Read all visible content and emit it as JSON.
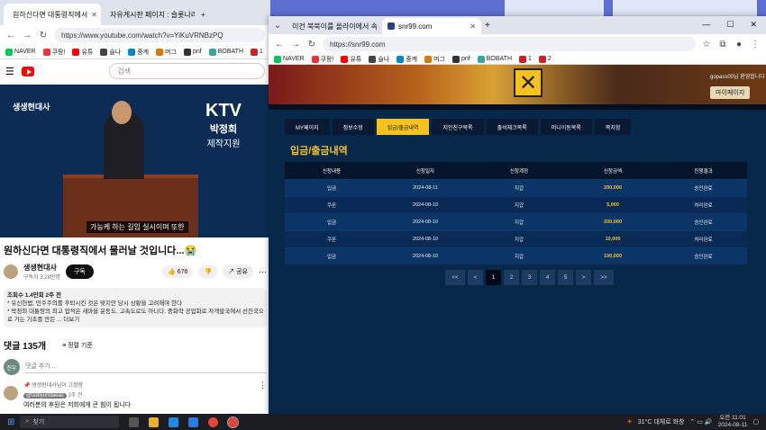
{
  "desktop": {
    "bg": "#5d6fd1"
  },
  "left_browser": {
    "tabs": [
      {
        "label": "원하신다면 대통령직에서",
        "active": true
      },
      {
        "label": "자유게시판 페이지 : 슬롯나라",
        "active": false
      }
    ],
    "new_tab": "+",
    "url": "https://www.youtube.com/watch?v=YiKuVRNBzPQ",
    "bookmarks": [
      "NAVER",
      "쿠팡!",
      "유튜",
      "슬나",
      "중계",
      "머그",
      "pnf",
      "BOBATH",
      "1",
      "2"
    ],
    "search_placeholder": "검색",
    "video": {
      "channel_tag": "생생현대사",
      "ktv_line1": "KTV",
      "ktv_line2": "박정희",
      "ktv_line3": "제작지원",
      "caption": "가능케 하는 길임 실시이며 또한"
    },
    "title": "원하신다면 대통령직에서 물러날 것입니다...😭",
    "channel": "생생현대사",
    "subs": "구독자 3.28만명",
    "subscribe": "구독",
    "likes": "676",
    "share": "공유",
    "desc_line1": "조회수 1.4만회  2주 전",
    "desc_line2": "* 유신헌법, 민주주의를 후퇴시킨 것은 맞지만 당시 상황을 고려해야 한다",
    "desc_line3": "* 박정희 대통령의 최고 업적은 새마을 운동도, 고속도로도 아니다. 중화학 공업화로 자개발국에서 선진국으",
    "desc_line4": "로 가는 기초를 만든 ... 더보기",
    "comments_count": "댓글 135개",
    "sort": "정렬 기준",
    "add_comment": "댓글 추가...",
    "me_avatar": "진우",
    "pinned": "생생현대사님이 고정함",
    "commenter": "@sobyundaeas",
    "comment_time": "2주 전",
    "comment_text": "여러분의 후원은 저희에게 큰 힘이 됩니다"
  },
  "right_browser": {
    "tabs": [
      {
        "label": "이건 북북이를 올라이에서 속",
        "active": false
      },
      {
        "label": "snr99.com",
        "active": true
      }
    ],
    "url": "https://snr99.com",
    "bookmarks": [
      "NAVER",
      "쿠팡!",
      "유튜",
      "슬나",
      "중계",
      "머그",
      "pnf",
      "BOBATH",
      "1",
      "2"
    ],
    "site": {
      "user": "gopass00님 환영합니다",
      "mypage": "마이페이지",
      "menu": [
        "MY페이지",
        "정보수정",
        "입금/출금내역",
        "지인친구목록",
        "출석체크목록",
        "머니이동목록",
        "쪽지함"
      ],
      "active_menu": 2,
      "section_title": "입금/출금내역",
      "columns": [
        "신청내용",
        "신청일자",
        "신청계정",
        "신청금액",
        "진행결과"
      ],
      "rows": [
        [
          "입금",
          "2024-08-11",
          "지갑",
          "200,000",
          "승인완료"
        ],
        [
          "쿠폰",
          "2024-08-10",
          "지갑",
          "5,000",
          "처리완료"
        ],
        [
          "입금",
          "2024-08-10",
          "지갑",
          "200,000",
          "승인완료"
        ],
        [
          "쿠폰",
          "2024-08-10",
          "지갑",
          "10,000",
          "처리완료"
        ],
        [
          "입금",
          "2024-08-10",
          "지갑",
          "100,000",
          "승인완료"
        ]
      ],
      "pager": [
        "<<",
        "<",
        "1",
        "2",
        "3",
        "4",
        "5",
        ">",
        ">>"
      ],
      "current_page": "1"
    }
  },
  "taskbar": {
    "search": "찾기",
    "weather": "31°C  대체로 화창",
    "time": "오전 11:01",
    "date": "2024-08-11"
  }
}
